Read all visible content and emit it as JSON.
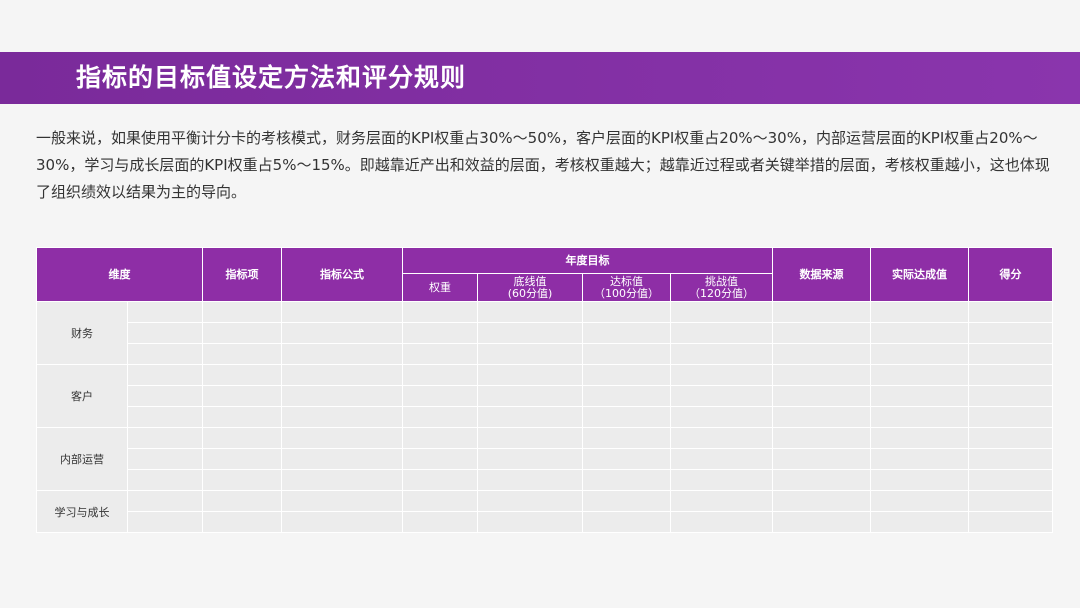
{
  "title": "指标的目标值设定方法和评分规则",
  "intro": "一般来说，如果使用平衡计分卡的考核模式，财务层面的KPI权重占30%～50%，客户层面的KPI权重占20%～30%，内部运营层面的KPI权重占20%～30%，学习与成长层面的KPI权重占5%～15%。即越靠近产出和效益的层面，考核权重越大；越靠近过程或者关键举措的层面，考核权重越小，这也体现了组织绩效以结果为主的导向。",
  "table": {
    "headers": {
      "dimension": "维度",
      "indicator": "指标项",
      "formula": "指标公式",
      "annual_target": "年度目标",
      "weight": "权重",
      "baseline": "底线值",
      "baseline_score": "(60分值)",
      "target": "达标值",
      "target_score": "（100分值）",
      "challenge": "挑战值",
      "challenge_score": "（120分值）",
      "data_source": "数据来源",
      "actual": "实际达成值",
      "score": "得分"
    },
    "dimensions": [
      "财务",
      "客户",
      "内部运营",
      "学习与成长"
    ]
  }
}
